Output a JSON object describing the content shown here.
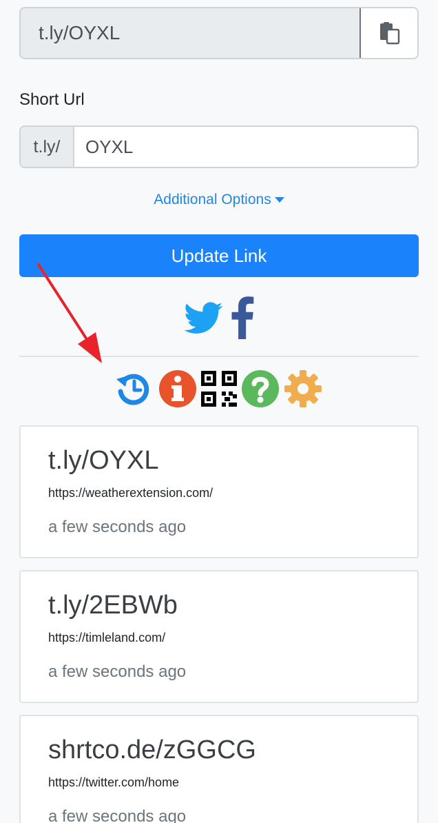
{
  "copy_box": {
    "value": "t.ly/OYXL",
    "icon": "clipboard-icon"
  },
  "short_url": {
    "label": "Short Url",
    "prefix": "t.ly/",
    "value": "OYXL"
  },
  "additional_options": {
    "label": "Additional Options"
  },
  "update_button": {
    "label": "Update Link"
  },
  "social_icons": [
    "twitter-icon",
    "facebook-icon"
  ],
  "toolbar_icons": [
    "history-icon",
    "info-icon",
    "qr-code-icon",
    "help-icon",
    "settings-icon"
  ],
  "links": [
    {
      "short": "t.ly/OYXL",
      "url": "https://weatherextension.com/",
      "time": "a few seconds ago"
    },
    {
      "short": "t.ly/2EBWb",
      "url": "https://timleland.com/",
      "time": "a few seconds ago"
    },
    {
      "short": "shrtco.de/zGGCG",
      "url": "https://twitter.com/home",
      "time": "a few seconds ago"
    }
  ],
  "colors": {
    "primary": "#1a82fb",
    "link": "#1f87e5",
    "twitter": "#1da1f2",
    "facebook": "#3b5998",
    "info": "#e8532b",
    "help": "#5cb85c",
    "settings": "#f0ad4e",
    "annotation_arrow": "#e8232b"
  }
}
